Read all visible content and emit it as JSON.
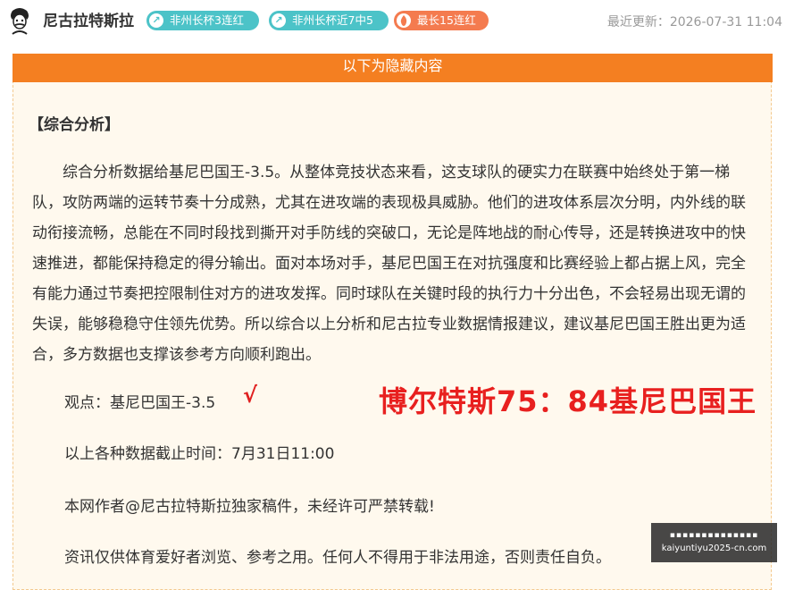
{
  "header": {
    "author": "尼古拉特斯拉",
    "badges": [
      {
        "icon": "↗",
        "label": "非州长杯3连红"
      },
      {
        "icon": "↗",
        "label": "非州长杯近7中5"
      },
      {
        "icon": "🔥",
        "label": "最长15连红"
      }
    ],
    "updated": "最近更新：2026-07-31 11:04"
  },
  "panel": {
    "bar_label": "以下为隐藏内容",
    "section_title": "【综合分析】",
    "paragraph": "综合分析数据给基尼巴国王-3.5。从整体竞技状态来看，这支球队的硬实力在联赛中始终处于第一梯队，攻防两端的运转节奏十分成熟，尤其在进攻端的表现极具威胁。他们的进攻体系层次分明，内外线的联动衔接流畅，总能在不同时段找到撕开对手防线的突破口，无论是阵地战的耐心传导，还是转换进攻中的快速推进，都能保持稳定的得分输出。面对本场对手，基尼巴国王在对抗强度和比赛经验上都占据上风，完全有能力通过节奏把控限制住对方的进攻发挥。同时球队在关键时段的执行力十分出色，不会轻易出现无谓的失误，能够稳稳守住领先优势。所以综合以上分析和尼古拉专业数据情报建议，建议基尼巴国王胜出更为适合，多方数据也支撑该参考方向顺利跑出。",
    "viewpoint": "观点：基尼巴国王-3.5",
    "check": "√",
    "result": "博尔特斯75：84基尼巴国王",
    "cutoff": "以上各种数据截止时间：7月31日11:00",
    "copyright": "本网作者@尼古拉特斯拉独家稿件，未经许可严禁转载!",
    "disclaimer": "资讯仅供体育爱好者浏览、参考之用。任何人不得用于非法用途，否则责任自负。"
  },
  "watermark": {
    "top": "▪▪▪▪▪▪▪▪▪▪▪▪▪▪",
    "url": "kaiyuntiyu2025-cn.com"
  },
  "colors": {
    "accent_orange": "#f47f21",
    "badge_teal": "#4cc3c8",
    "badge_orange": "#f47b4f",
    "result_red": "#e8201f"
  }
}
